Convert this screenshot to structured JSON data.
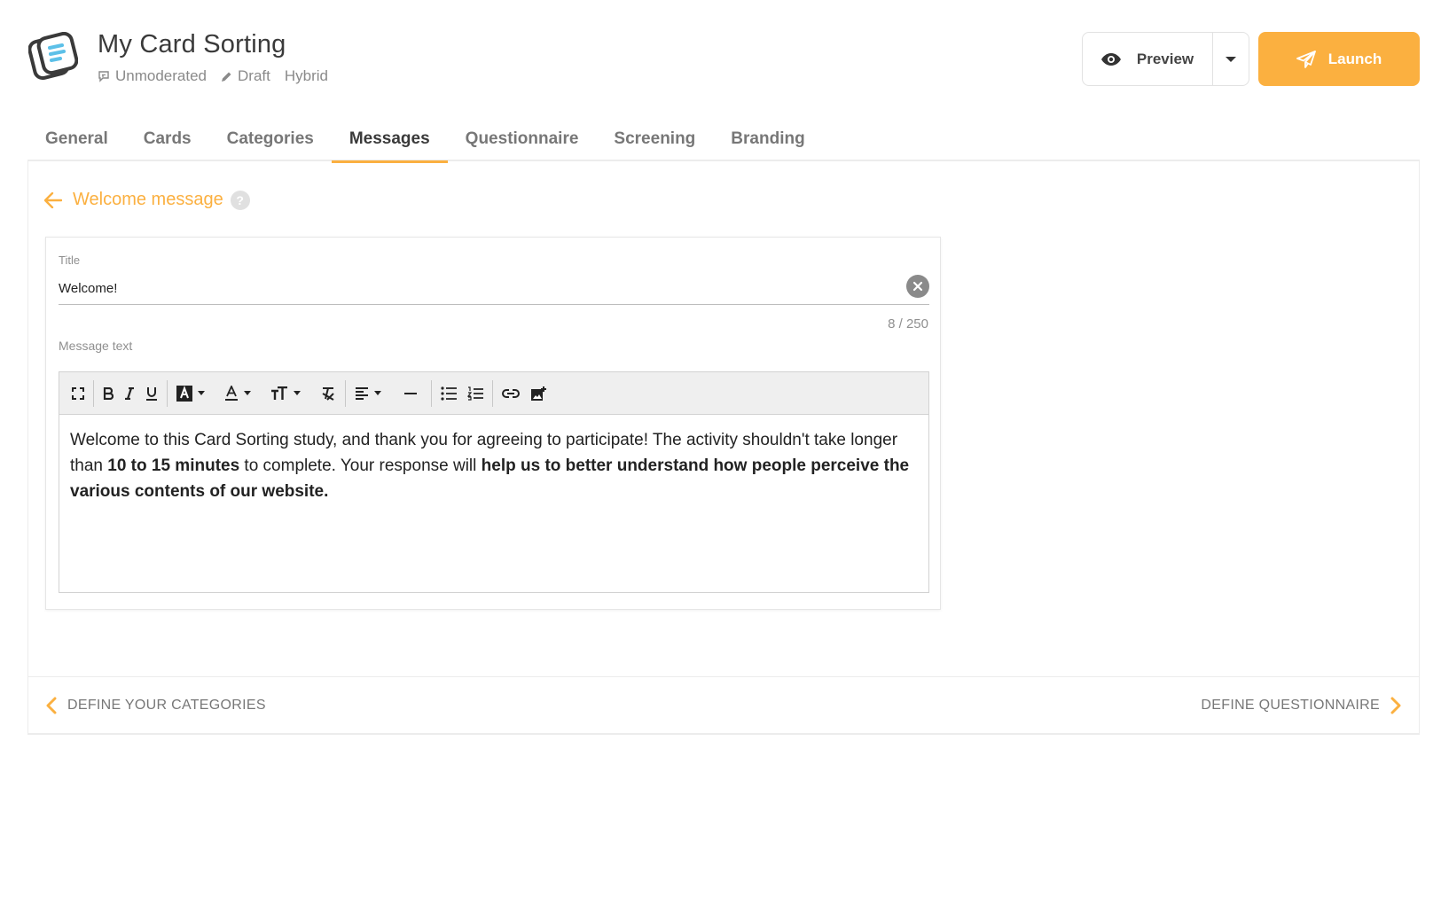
{
  "header": {
    "title": "My Card Sorting",
    "meta": [
      {
        "icon": "moderation-icon",
        "label": "Unmoderated"
      },
      {
        "icon": "pencil-icon",
        "label": "Draft"
      },
      {
        "icon": "",
        "label": "Hybrid"
      }
    ],
    "preview_label": "Preview",
    "launch_label": "Launch"
  },
  "tabs": [
    {
      "label": "General",
      "active": false
    },
    {
      "label": "Cards",
      "active": false
    },
    {
      "label": "Categories",
      "active": false
    },
    {
      "label": "Messages",
      "active": true
    },
    {
      "label": "Questionnaire",
      "active": false
    },
    {
      "label": "Screening",
      "active": false
    },
    {
      "label": "Branding",
      "active": false
    }
  ],
  "section": {
    "heading": "Welcome message",
    "help": "?"
  },
  "form": {
    "title_label": "Title",
    "title_value": "Welcome!",
    "counter": "8 / 250",
    "message_label": "Message text",
    "message": {
      "part1": "Welcome to this Card Sorting study, and thank you for agreeing to participate! The activity shouldn't take longer than ",
      "bold1": "10 to 15 minutes",
      "part2": " to complete. Your response will ",
      "bold2": "help us to better understand how people perceive the various contents of our website."
    }
  },
  "footer": {
    "prev_label": "DEFINE YOUR CATEGORIES",
    "next_label": "DEFINE QUESTIONNAIRE"
  },
  "colors": {
    "accent": "#fbb040",
    "text": "#3a3a3a",
    "muted": "#8a8a8a"
  }
}
